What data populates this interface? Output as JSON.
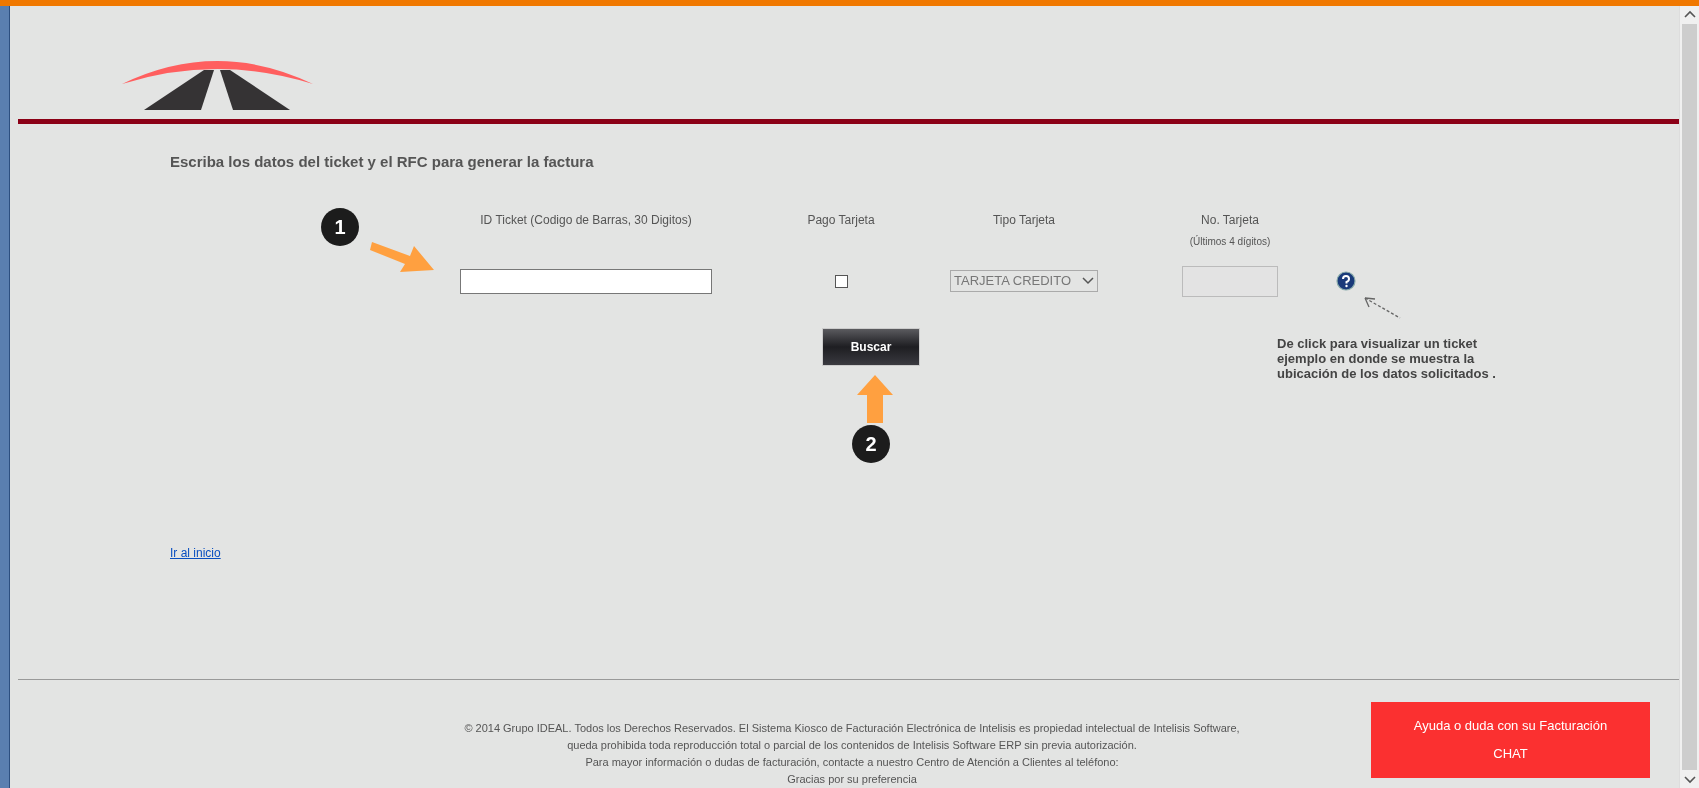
{
  "heading": "Escriba los datos del ticket y el RFC para generar la factura",
  "form": {
    "fields": [
      {
        "kind": "text",
        "label": "ID Ticket (Codigo de Barras, 30 Digitos)",
        "disabled": false
      },
      {
        "kind": "checkbox",
        "label": "Pago Tarjeta",
        "checked": false
      },
      {
        "kind": "select",
        "label": "Tipo Tarjeta",
        "value": "TARJETA CREDITO"
      },
      {
        "kind": "text",
        "label": "No. Tarjeta",
        "sublabel": "(Últimos 4 dígitos)",
        "disabled": true
      }
    ],
    "help_note": "De click  para visualizar un ticket ejemplo en donde se muestra la ubicación de los datos solicitados .",
    "search_button": "Buscar",
    "steps": [
      "1",
      "2"
    ]
  },
  "home_link": "Ir al inicio",
  "footer": {
    "lines": [
      "© 2014 Grupo IDEAL. Todos los Derechos Reservados. El Sistema Kiosco de Facturación Electrónica de Intelisis es propiedad intelectual de Intelisis Software,",
      "queda prohibida toda reproducción total o parcial de los contenidos de Intelisis Software ERP sin previa autorización.",
      "Para mayor información o dudas de facturación, contacte a nuestro Centro de Atención a Clientes al teléfono:",
      "Gracias por su preferencia"
    ],
    "chat_button": [
      "Ayuda o duda con su Facturación",
      "CHAT"
    ]
  }
}
